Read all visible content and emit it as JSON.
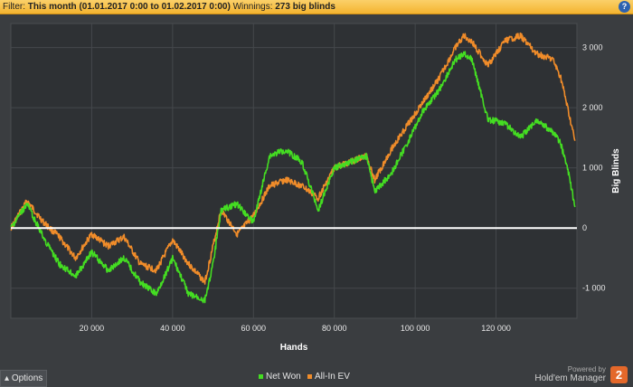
{
  "filter": {
    "prefix": "Filter:",
    "range": "This month (01.01.2017 0:00 to 01.02.2017 0:00)",
    "winnings_label": "Winnings:",
    "winnings_value": "273 big blinds",
    "help_glyph": "?"
  },
  "options_label": "Options",
  "options_glyph": "▴",
  "powered": {
    "line1": "Powered by",
    "line2": "Hold'em Manager",
    "logo": "2"
  },
  "colors": {
    "net_won": "#44dd22",
    "all_in_ev": "#f08c2a",
    "zero_line": "#ffffff",
    "background": "#3a3d40"
  },
  "chart_data": {
    "type": "line",
    "xlabel": "Hands",
    "ylabel": "Big Blinds",
    "xlim": [
      0,
      140000
    ],
    "ylim": [
      -1500,
      3400
    ],
    "x_ticks": [
      20000,
      40000,
      60000,
      80000,
      100000,
      120000
    ],
    "x_tick_labels": [
      "20 000",
      "40 000",
      "60 000",
      "80 000",
      "100 000",
      "120 000"
    ],
    "y_ticks": [
      -1000,
      0,
      1000,
      2000,
      3000
    ],
    "y_tick_labels": [
      "-1 000",
      "0",
      "1 000",
      "2 000",
      "3 000"
    ],
    "grid": true,
    "legend": "bottom-center",
    "x": [
      0,
      4000,
      8000,
      12000,
      16000,
      20000,
      24000,
      28000,
      32000,
      36000,
      40000,
      44000,
      48000,
      50000,
      52000,
      56000,
      60000,
      64000,
      68000,
      72000,
      76000,
      80000,
      84000,
      88000,
      90000,
      94000,
      98000,
      102000,
      106000,
      110000,
      112000,
      114000,
      118000,
      122000,
      126000,
      130000,
      134000,
      136000,
      138000,
      139500
    ],
    "series": [
      {
        "name": "Net Won",
        "values": [
          0,
          400,
          -150,
          -600,
          -800,
          -400,
          -700,
          -500,
          -900,
          -1100,
          -500,
          -1100,
          -1200,
          -600,
          300,
          400,
          100,
          1200,
          1300,
          1100,
          300,
          1000,
          1100,
          1200,
          600,
          900,
          1400,
          1950,
          2300,
          2800,
          2900,
          2800,
          1800,
          1750,
          1500,
          1800,
          1600,
          1400,
          900,
          350
        ]
      },
      {
        "name": "All-In EV",
        "values": [
          0,
          450,
          100,
          -150,
          -500,
          -100,
          -300,
          -150,
          -600,
          -700,
          -200,
          -600,
          -900,
          -300,
          300,
          -100,
          200,
          700,
          800,
          700,
          500,
          1000,
          1100,
          1200,
          800,
          1300,
          1700,
          2100,
          2500,
          3000,
          3200,
          3100,
          2700,
          3100,
          3200,
          2900,
          2800,
          2500,
          1900,
          1450
        ]
      }
    ]
  }
}
